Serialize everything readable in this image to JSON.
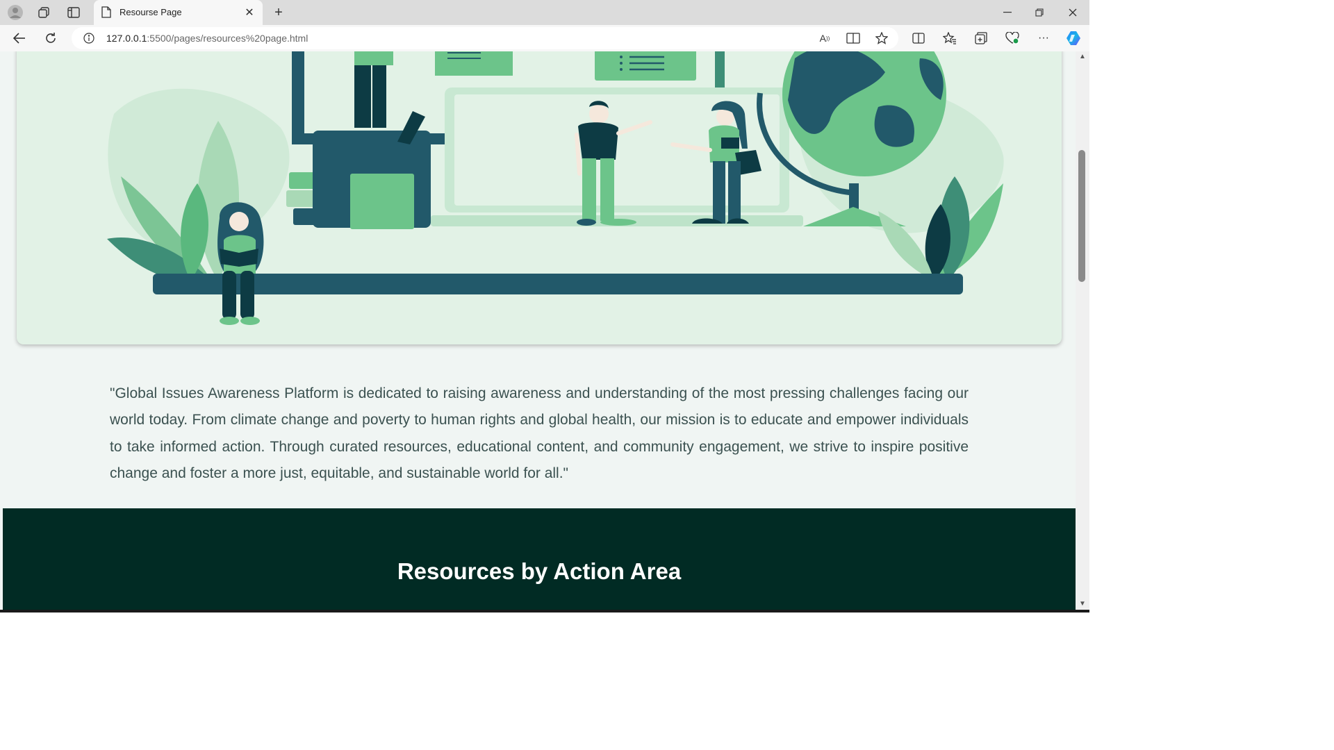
{
  "browser": {
    "tab_title": "Resourse Page",
    "url_host": "127.0.0.1",
    "url_path": ":5500/pages/resources%20page.html",
    "new_tab": "+",
    "close": "✕"
  },
  "page": {
    "hero_alt": "people learning illustration",
    "mission_text": "\"Global Issues Awareness Platform is dedicated to raising awareness and understanding of the most pressing challenges facing our world today. From climate change and poverty to human rights and global health, our mission is to educate and empower individuals to take informed action. Through curated resources, educational content, and community engagement, we strive to inspire positive change and foster a more just, equitable, and sustainable world for all.\"",
    "section_title": "Resources by Action Area"
  },
  "colors": {
    "hero_bg": "#e2f2e6",
    "dark_green": "#012b24",
    "teal": "#22596a",
    "green": "#6cc48a"
  }
}
